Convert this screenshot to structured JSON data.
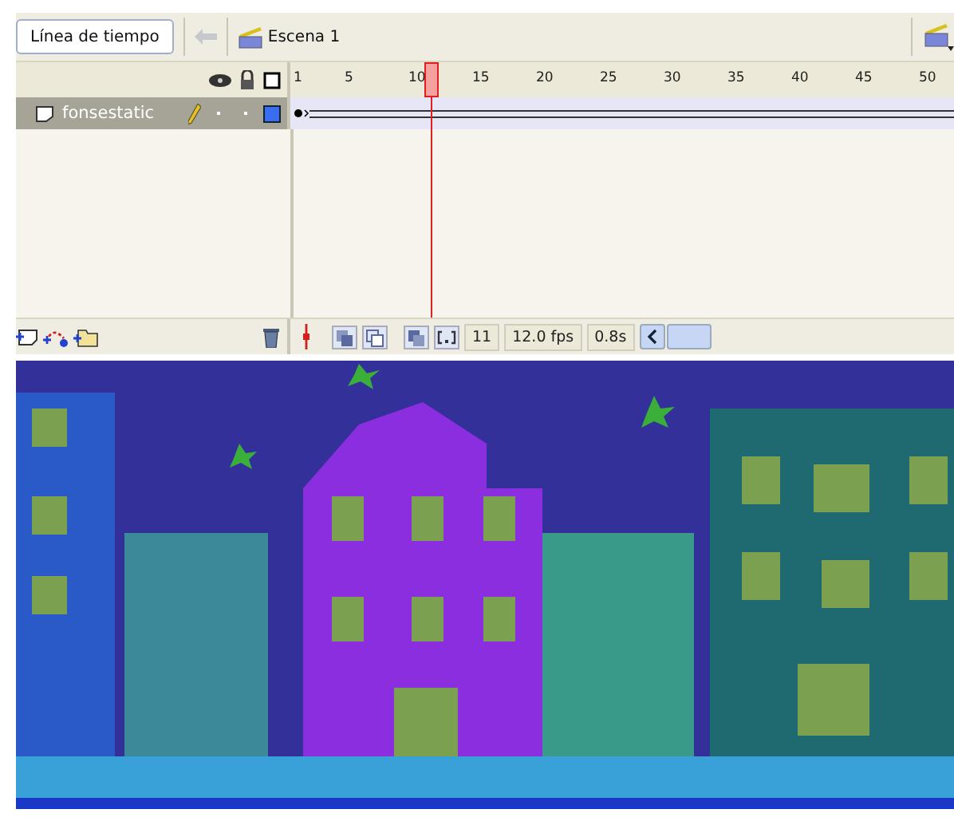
{
  "toolbar": {
    "timeline_button": "Línea de tiempo",
    "scene": "Escena 1"
  },
  "ruler": {
    "ticks": [
      "1",
      "5",
      "10",
      "15",
      "20",
      "25",
      "30",
      "35",
      "40",
      "45",
      "50"
    ]
  },
  "playhead": {
    "level": 0.207
  },
  "layers": [
    {
      "name": "fonsestatic",
      "selected": true
    }
  ],
  "status": {
    "frame": "11",
    "fps": "12.0 fps",
    "time": "0.8s"
  }
}
